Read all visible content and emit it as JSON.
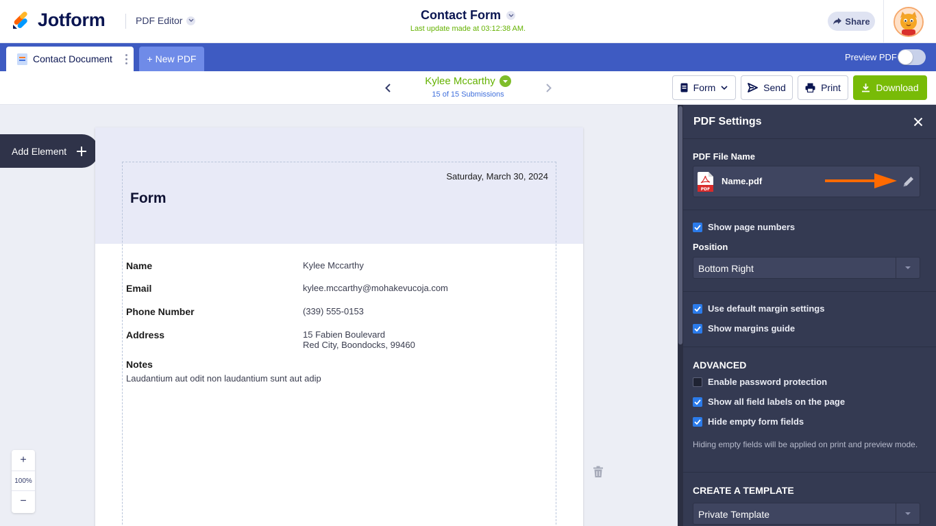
{
  "header": {
    "logo_text": "Jotform",
    "editor_label": "PDF Editor",
    "form_title": "Contact Form",
    "last_update": "Last update made at 03:12:38 AM.",
    "share_label": "Share"
  },
  "tabs": {
    "active_tab": "Contact Document",
    "new_pdf": "+ New PDF",
    "preview_label": "Preview PDF",
    "preview_enabled": false
  },
  "toolbar": {
    "submitter_name": "Kylee Mccarthy",
    "submission_count": "15 of 15 Submissions",
    "form_button": "Form",
    "send_button": "Send",
    "print_button": "Print",
    "download_button": "Download"
  },
  "canvas": {
    "add_element": "Add Element",
    "zoom_in": "+",
    "zoom_level": "100%",
    "zoom_out": "−"
  },
  "document": {
    "date": "Saturday, March 30, 2024",
    "title": "Form",
    "fields": {
      "name_label": "Name",
      "name_value": "Kylee Mccarthy",
      "email_label": "Email",
      "email_value": "kylee.mccarthy@mohakevucoja.com",
      "phone_label": "Phone Number",
      "phone_value": "(339) 555-0153",
      "address_label": "Address",
      "address_line1": "15 Fabien Boulevard",
      "address_line2": "Red City, Boondocks, 99460",
      "notes_label": "Notes",
      "notes_value": "Laudantium aut odit non laudantium sunt aut adip"
    }
  },
  "settings": {
    "title": "PDF Settings",
    "file_name_label": "PDF File Name",
    "file_name": "Name.pdf",
    "file_icon_text": "PDF",
    "show_page_numbers": {
      "label": "Show page numbers",
      "checked": true
    },
    "position_label": "Position",
    "position_value": "Bottom Right",
    "default_margins": {
      "label": "Use default margin settings",
      "checked": true
    },
    "margins_guide": {
      "label": "Show margins guide",
      "checked": true
    },
    "advanced_heading": "ADVANCED",
    "password_protection": {
      "label": "Enable password protection",
      "checked": false
    },
    "show_all_labels": {
      "label": "Show all field labels on the page",
      "checked": true
    },
    "hide_empty": {
      "label": "Hide empty form fields",
      "checked": true
    },
    "hide_empty_note": "Hiding empty fields will be applied on print and preview mode.",
    "template_heading": "CREATE A TEMPLATE",
    "template_value": "Private Template"
  },
  "colors": {
    "brand_blue": "#3e5bc2",
    "accent_green": "#78bb07",
    "panel_bg": "#343a52",
    "arrow_orange": "#ff6a00"
  }
}
